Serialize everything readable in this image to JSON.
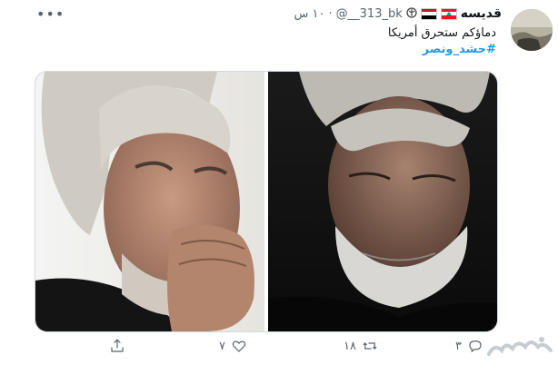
{
  "tweet": {
    "display_name": "قديسه",
    "handle": "@__313_bk",
    "time": "١٠ س",
    "text": "دماؤكم ستحرق أمريكا",
    "hashtag": "#حشد_ونصر",
    "media_alt": "Two portrait photographs side by side: a grey-haired man with his hand to his chin, and a grey-bearded man looking down",
    "colors": {
      "accent": "#1d9bf0",
      "secondary": "#536471"
    }
  },
  "actions": {
    "reply_count": "٣",
    "retweet_count": "١٨",
    "like_count": "٧"
  },
  "icons": [
    "more-icon",
    "reply-icon",
    "retweet-icon",
    "like-icon",
    "share-icon"
  ]
}
